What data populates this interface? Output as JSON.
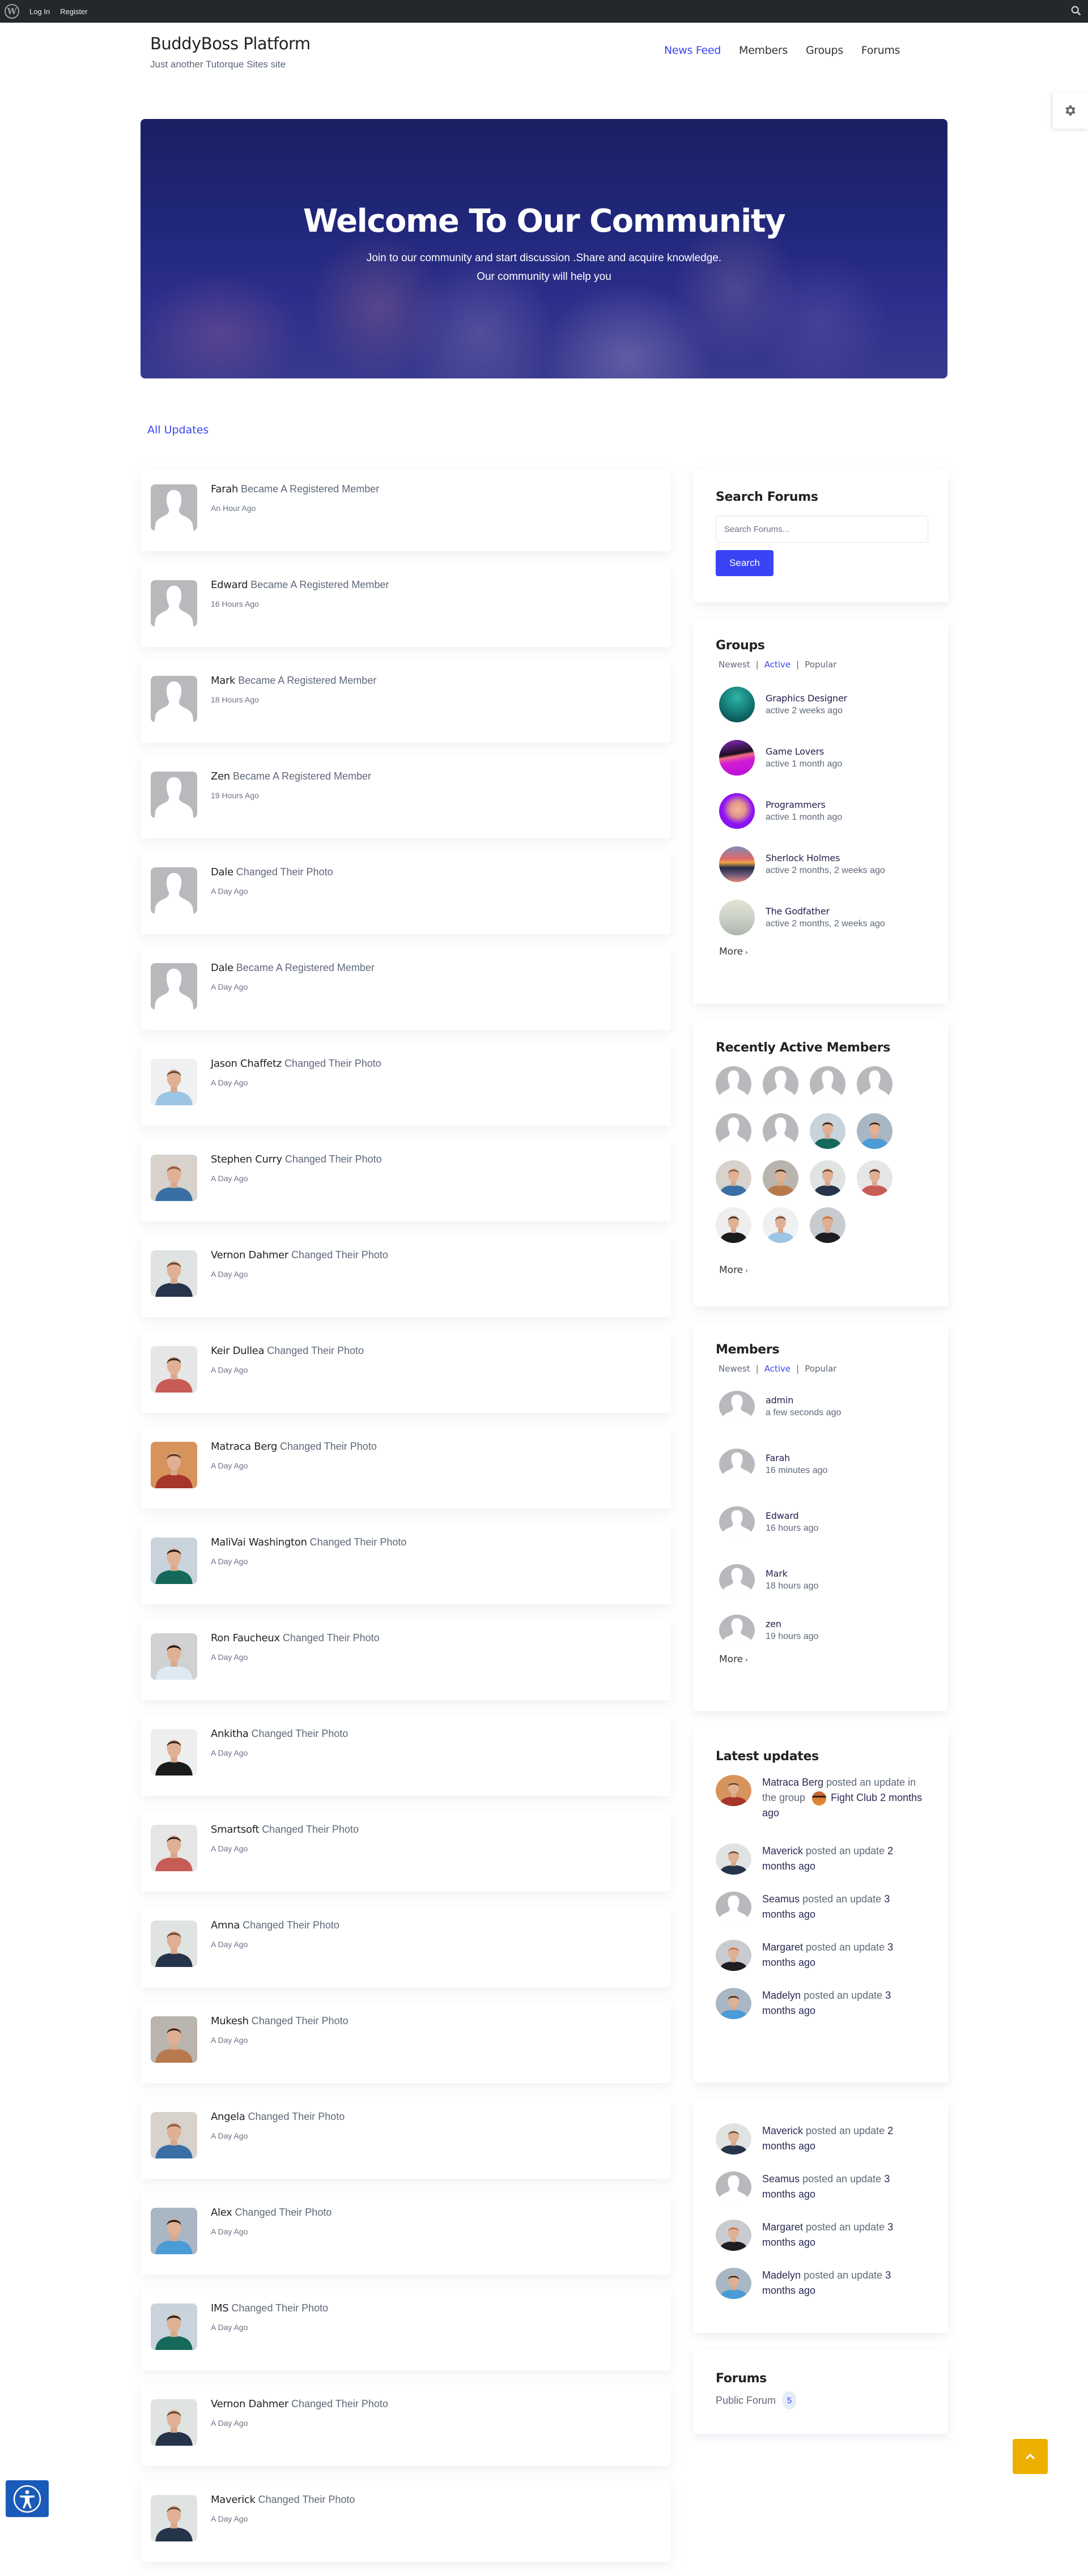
{
  "adminbar": {
    "logo_icon": "wordpress-icon",
    "login_label": "Log In",
    "register_label": "Register",
    "search_icon": "search-icon"
  },
  "header": {
    "site_title": "BuddyBoss Platform",
    "site_description": "Just another Tutorque Sites site",
    "nav": [
      {
        "label": "News Feed",
        "active": true
      },
      {
        "label": "Members",
        "active": false
      },
      {
        "label": "Groups",
        "active": false
      },
      {
        "label": "Forums",
        "active": false
      }
    ],
    "settings_icon": "gear-icon"
  },
  "hero": {
    "title": "Welcome To Our Community",
    "subtitle_line1": "Join to our community and start discussion .Share and acquire knowledge.",
    "subtitle_line2": "Our community will help you"
  },
  "feed": {
    "filter_label": "All Updates",
    "items": [
      {
        "name": "Farah",
        "action": "Became A Registered Member",
        "time": "An Hour Ago",
        "avatar": "placeholder"
      },
      {
        "name": "Edward",
        "action": "Became A Registered Member",
        "time": "16 Hours Ago",
        "avatar": "placeholder"
      },
      {
        "name": "Mark",
        "action": "Became A Registered Member",
        "time": "18 Hours Ago",
        "avatar": "placeholder"
      },
      {
        "name": "Zen",
        "action": "Became A Registered Member",
        "time": "19 Hours Ago",
        "avatar": "placeholder"
      },
      {
        "name": "Dale",
        "action": "Changed Their Photo",
        "time": "A Day Ago",
        "avatar": "placeholder"
      },
      {
        "name": "Dale",
        "action": "Became A Registered Member",
        "time": "A Day Ago",
        "avatar": "placeholder"
      },
      {
        "name": "Jason Chaffetz",
        "action": "Changed Their Photo",
        "time": "A Day Ago",
        "avatar": "photo-lightblue-shirt"
      },
      {
        "name": "Stephen Curry",
        "action": "Changed Their Photo",
        "time": "A Day Ago",
        "avatar": "photo-denim"
      },
      {
        "name": "Vernon Dahmer",
        "action": "Changed Their Photo",
        "time": "A Day Ago",
        "avatar": "photo-dark-jacket"
      },
      {
        "name": "Keir Dullea",
        "action": "Changed Their Photo",
        "time": "A Day Ago",
        "avatar": "photo-plaid"
      },
      {
        "name": "Matraca Berg",
        "action": "Changed Their Photo",
        "time": "A Day Ago",
        "avatar": "photo-orange-plaid"
      },
      {
        "name": "MaliVai Washington",
        "action": "Changed Their Photo",
        "time": "A Day Ago",
        "avatar": "photo-green-sweater"
      },
      {
        "name": "Ron Faucheux",
        "action": "Changed Their Photo",
        "time": "A Day Ago",
        "avatar": "photo-tie"
      },
      {
        "name": "Ankitha",
        "action": "Changed Their Photo",
        "time": "A Day Ago",
        "avatar": "photo-black-tee"
      },
      {
        "name": "Smartsoft",
        "action": "Changed Their Photo",
        "time": "A Day Ago",
        "avatar": "photo-plaid"
      },
      {
        "name": "Amna",
        "action": "Changed Their Photo",
        "time": "A Day Ago",
        "avatar": "photo-dark-jacket"
      },
      {
        "name": "Mukesh",
        "action": "Changed Their Photo",
        "time": "A Day Ago",
        "avatar": "photo-tan-shirt"
      },
      {
        "name": "Angela",
        "action": "Changed Their Photo",
        "time": "A Day Ago",
        "avatar": "photo-denim"
      },
      {
        "name": "Alex",
        "action": "Changed Their Photo",
        "time": "A Day Ago",
        "avatar": "photo-blue-shirt"
      },
      {
        "name": "IMS",
        "action": "Changed Their Photo",
        "time": "A Day Ago",
        "avatar": "photo-green-sweater"
      },
      {
        "name": "Vernon Dahmer",
        "action": "Changed Their Photo",
        "time": "A Day Ago",
        "avatar": "photo-dark-jacket"
      },
      {
        "name": "Maverick",
        "action": "Changed Their Photo",
        "time": "A Day Ago",
        "avatar": "photo-dark-jacket"
      }
    ]
  },
  "sidebar": {
    "search_forums": {
      "title": "Search Forums",
      "placeholder": "Search Forums...",
      "value": "",
      "button_label": "Search"
    },
    "groups": {
      "title": "Groups",
      "tabs": [
        {
          "label": "Newest",
          "active": false
        },
        {
          "label": "Active",
          "active": true
        },
        {
          "label": "Popular",
          "active": false
        }
      ],
      "items": [
        {
          "name": "Graphics Designer",
          "meta": "active 2 weeks ago",
          "avatar": "teal"
        },
        {
          "name": "Game Lovers",
          "meta": "active 1 month ago",
          "avatar": "magenta"
        },
        {
          "name": "Programmers",
          "meta": "active 1 month ago",
          "avatar": "purple"
        },
        {
          "name": "Sherlock Holmes",
          "meta": "active 2 months, 2 weeks ago",
          "avatar": "sunset"
        },
        {
          "name": "The Godfather",
          "meta": "active 2 months, 2 weeks ago",
          "avatar": "pale"
        }
      ],
      "more_label": "More"
    },
    "recently_active": {
      "title": "Recently Active Members",
      "avatars": [
        "placeholder",
        "placeholder",
        "placeholder",
        "placeholder",
        "placeholder",
        "placeholder",
        "photo-green-sweater",
        "photo-blue-shirt",
        "photo-denim",
        "photo-tan-shirt",
        "photo-dark-jacket",
        "photo-plaid",
        "photo-black-tee",
        "photo-lightblue-shirt",
        "photo-suit"
      ],
      "more_label": "More"
    },
    "members": {
      "title": "Members",
      "tabs": [
        {
          "label": "Newest",
          "active": false
        },
        {
          "label": "Active",
          "active": true
        },
        {
          "label": "Popular",
          "active": false
        }
      ],
      "items": [
        {
          "name": "admin",
          "meta": "a few seconds ago"
        },
        {
          "name": "Farah",
          "meta": "16 minutes ago"
        },
        {
          "name": "Edward",
          "meta": "16 hours ago"
        },
        {
          "name": "Mark",
          "meta": "18 hours ago"
        },
        {
          "name": "zen",
          "meta": "19 hours ago"
        }
      ],
      "more_label": "More"
    },
    "latest_updates": {
      "title": "Latest updates",
      "items": [
        {
          "name": "Matraca Berg",
          "action": "posted an update in the group",
          "group": "Fight Club",
          "time": "2 months ago",
          "avatar": "photo-orange-plaid"
        },
        {
          "name": "Maverick",
          "action": "posted an update",
          "time": "2 months ago",
          "avatar": "photo-dark-jacket"
        },
        {
          "name": "Seamus",
          "action": "posted an update",
          "time": "3 months ago",
          "avatar": "placeholder"
        },
        {
          "name": "Margaret",
          "action": "posted an update",
          "time": "3 months ago",
          "avatar": "photo-suit"
        },
        {
          "name": "Madelyn",
          "action": "posted an update",
          "time": "3 months ago",
          "avatar": "photo-blue-shirt"
        }
      ]
    },
    "updates_2": {
      "items": [
        {
          "name": "Maverick",
          "action": "posted an update",
          "time": "2 months ago",
          "avatar": "photo-dark-jacket"
        },
        {
          "name": "Seamus",
          "action": "posted an update",
          "time": "3 months ago",
          "avatar": "placeholder"
        },
        {
          "name": "Margaret",
          "action": "posted an update",
          "time": "3 months ago",
          "avatar": "photo-suit"
        },
        {
          "name": "Madelyn",
          "action": "posted an update",
          "time": "3 months ago",
          "avatar": "photo-blue-shirt"
        }
      ]
    },
    "forums": {
      "title": "Forums",
      "items": [
        {
          "name": "Public Forum",
          "count": "5"
        }
      ]
    }
  },
  "floating": {
    "scroll_top_icon": "chevron-up-icon",
    "accessibility_icon": "accessibility-icon"
  },
  "colors": {
    "accent": "#3a45f0",
    "button": "#3a43f5",
    "scroll_top": "#eeb000",
    "accessibility": "#1a5ab8",
    "adminbar": "#23282d"
  }
}
